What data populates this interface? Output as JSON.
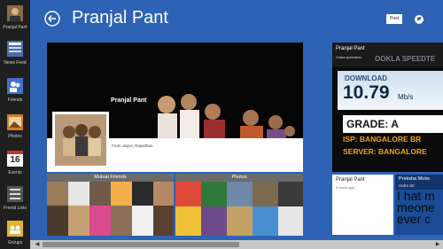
{
  "nav": {
    "items": [
      {
        "label": "Pranjal Pant",
        "icon": "avatar-icon"
      },
      {
        "label": "News Feed",
        "icon": "news-feed-icon"
      },
      {
        "label": "Friends",
        "icon": "friends-icon"
      },
      {
        "label": "Photos",
        "icon": "photos-icon"
      },
      {
        "label": "Events",
        "icon": "calendar-icon",
        "day": "16"
      },
      {
        "label": "Friend Lists",
        "icon": "friend-lists-icon"
      },
      {
        "label": "Groups",
        "icon": "groups-icon"
      }
    ]
  },
  "header": {
    "title": "Pranjal Pant",
    "post_label": "Post"
  },
  "cover": {
    "name": "Pranjal Pant",
    "from": "From Jaipur, Rajasthan"
  },
  "sections": {
    "mutual_friends": "Mutual Friends",
    "photos": "Photos"
  },
  "speedtest": {
    "name": "Pranjal Pant",
    "overlay": "Ookla speedtest",
    "logo": "OOKLA SPEEDTE",
    "download_label": "DOWNLOAD",
    "download_value": "10.79",
    "unit": "Mb/s",
    "grade": "GRADE: A",
    "isp": "ISP: BANGALORE BR",
    "server": "SERVER: BANGALORE"
  },
  "post_card": {
    "name": "Pranjal Pant",
    "time": "9 hours ago"
  },
  "status_card": {
    "name": "Preksha Motw",
    "sub": "Haha xD",
    "text": "I hat m\nmeone\never c"
  },
  "colors": {
    "background": "#2e62b5",
    "nav": "#1f1f1f",
    "isp_text": "#f0a020"
  }
}
